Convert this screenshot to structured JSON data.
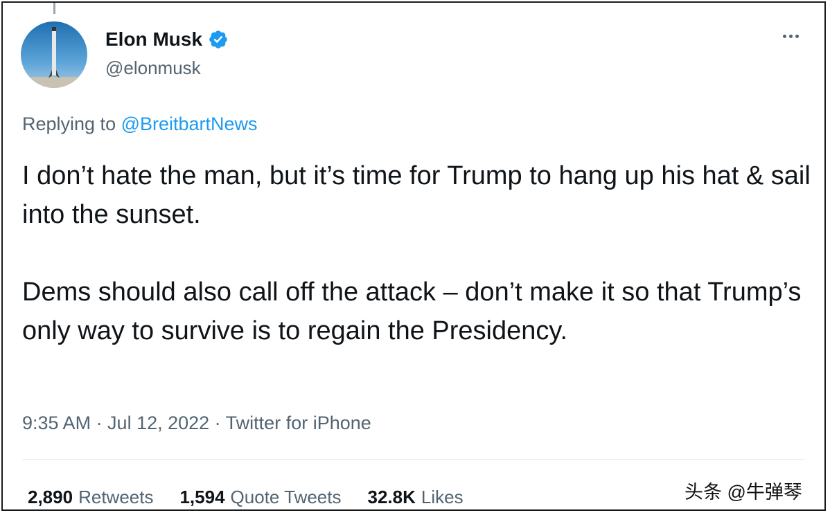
{
  "tweet": {
    "author_name": "Elon Musk",
    "handle": "@elonmusk",
    "reply_prefix": "Replying to ",
    "reply_target": "@BreitbartNews",
    "paragraphs": [
      "I don’t hate the man, but it’s time for Trump to hang up his hat & sail into the sunset.",
      "Dems should also call off the attack – don’t make it so that Trump’s only way to survive is to regain the Presidency."
    ],
    "timestamp": "9:35 AM · Jul 12, 2022 · Twitter for iPhone",
    "stats": {
      "retweets_count": "2,890",
      "retweets_label": "Retweets",
      "quotes_count": "1,594",
      "quotes_label": "Quote Tweets",
      "likes_count": "32.8K",
      "likes_label": "Likes"
    }
  },
  "icons": {
    "verified": "verified-badge-icon",
    "more": "more-options-icon"
  },
  "colors": {
    "accent": "#1d9bf0",
    "secondary_text": "#536471",
    "primary_text": "#0f1419"
  },
  "watermark": "头条 @牛弹琴"
}
